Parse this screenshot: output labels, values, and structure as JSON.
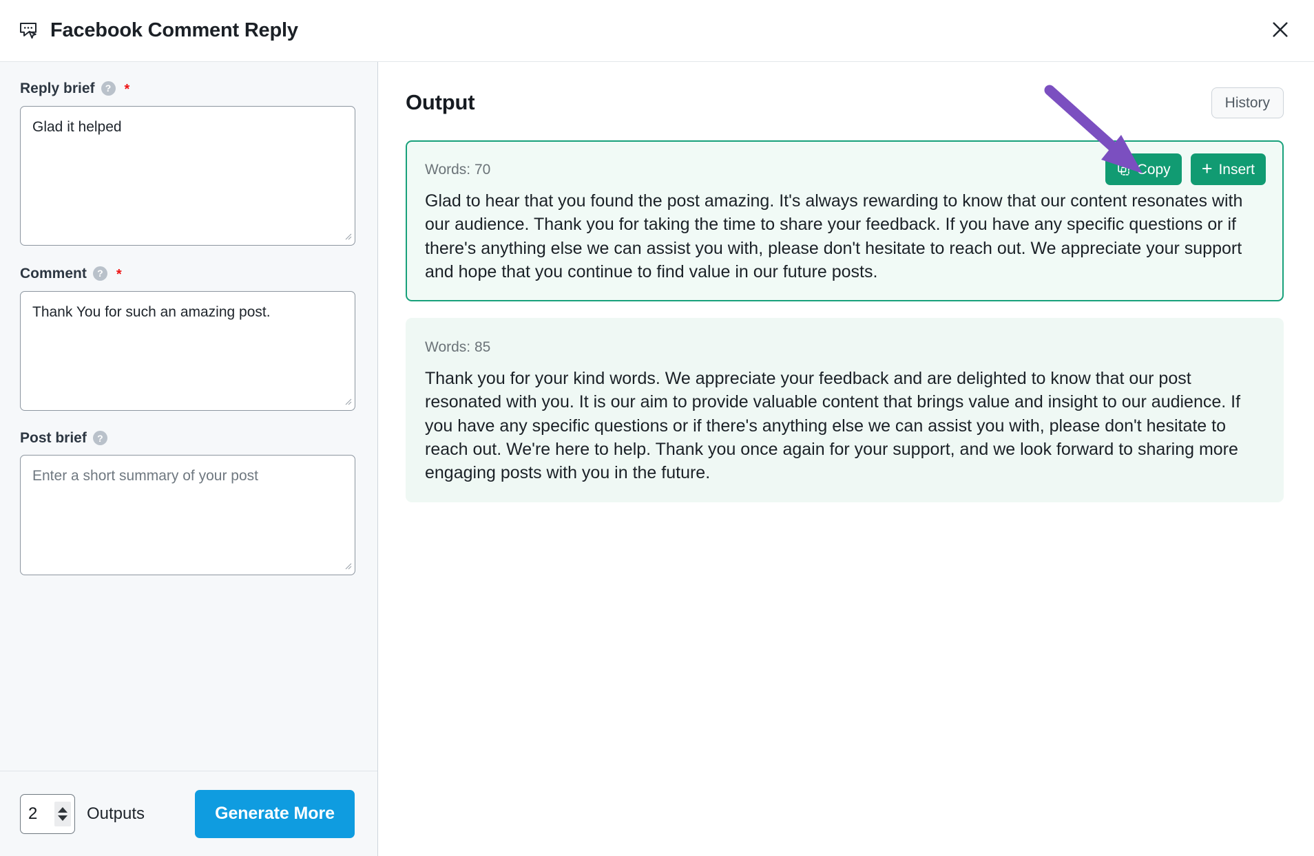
{
  "header": {
    "icon": "comment-reply-icon",
    "title": "Facebook Comment Reply",
    "close_icon": "close-icon"
  },
  "form": {
    "fields": [
      {
        "label": "Reply brief",
        "help_icon": "question-mark-icon",
        "required": true,
        "required_marker": "*",
        "value": "Glad it helped",
        "placeholder": ""
      },
      {
        "label": "Comment",
        "help_icon": "question-mark-icon",
        "required": true,
        "required_marker": "*",
        "value": "Thank You for such an amazing post.",
        "placeholder": ""
      },
      {
        "label": "Post brief",
        "help_icon": "question-mark-icon",
        "required": false,
        "required_marker": "",
        "value": "",
        "placeholder": "Enter a short summary of your post"
      }
    ],
    "footer": {
      "outputs_count": "2",
      "outputs_label": "Outputs",
      "generate_label": "Generate More",
      "generate_color": "#0f9ce0",
      "stepper_up_icon": "chevron-up-icon",
      "stepper_down_icon": "chevron-down-icon"
    }
  },
  "output": {
    "title": "Output",
    "history_label": "History",
    "accent_color": "#17a07a",
    "action_button_color": "#119b72",
    "cards": [
      {
        "words_label": "Words: 70",
        "selected": true,
        "copy_label": "Copy",
        "copy_icon": "copy-icon",
        "insert_label": "Insert",
        "insert_icon": "plus-icon",
        "text": "Glad to hear that you found the post amazing. It's always rewarding to know that our content resonates with our audience. Thank you for taking the time to share your feedback. If you have any specific questions or if there's anything else we can assist you with, please don't hesitate to reach out. We appreciate your support and hope that you continue to find value in our future posts."
      },
      {
        "words_label": "Words: 85",
        "selected": false,
        "copy_label": "",
        "copy_icon": "",
        "insert_label": "",
        "insert_icon": "",
        "text": "Thank you for your kind words. We appreciate your feedback and are delighted to know that our post resonated with you. It is our aim to provide valuable content that brings value and insight to our audience. If you have any specific questions or if there's anything else we can assist you with, please don't hesitate to reach out. We're here to help. Thank you once again for your support, and we look forward to sharing more engaging posts with you in the future."
      }
    ]
  },
  "annotation": {
    "type": "arrow",
    "color": "#7b4fc0",
    "points_to": "copy-button"
  }
}
